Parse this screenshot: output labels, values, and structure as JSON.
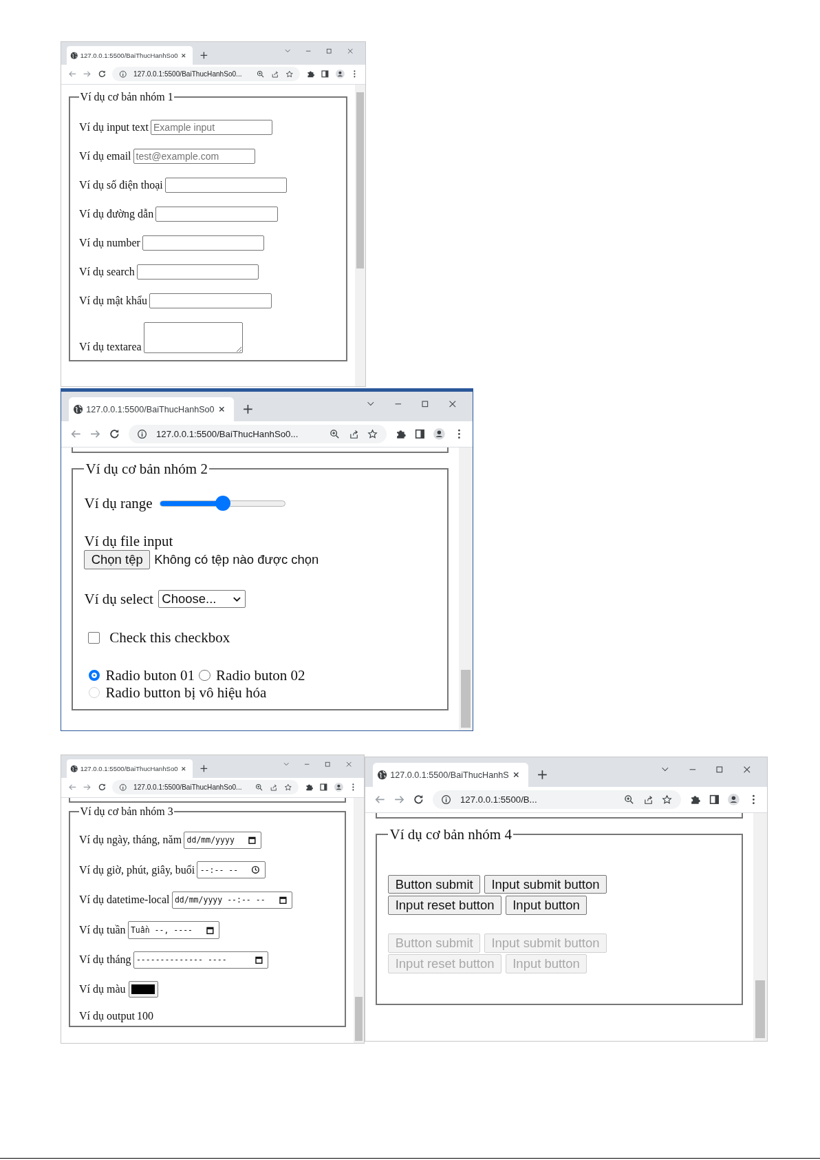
{
  "windows": [
    {
      "tab_title": "127.0.0.1:5500/BaiThucHanhSo0",
      "url": "127.0.0.1:5500/BaiThucHanhSo0...",
      "focused": false,
      "scrolled": false,
      "legend": "Ví dụ cơ bản nhóm 1",
      "rows": [
        {
          "kind": "text",
          "label": "Ví dụ input text",
          "placeholder": "Example input"
        },
        {
          "kind": "text",
          "label": "Ví dụ email",
          "placeholder": "test@example.com"
        },
        {
          "kind": "text",
          "label": "Ví dụ số điện thoại"
        },
        {
          "kind": "text",
          "label": "Ví dụ đường dẫn"
        },
        {
          "kind": "text",
          "label": "Ví dụ number"
        },
        {
          "kind": "text",
          "label": "Ví dụ search"
        },
        {
          "kind": "text",
          "label": "Ví dụ mật khẩu"
        },
        {
          "kind": "textarea",
          "label": "Ví dụ textarea"
        }
      ]
    },
    {
      "tab_title": "127.0.0.1:5500/BaiThucHanhSo0",
      "url": "127.0.0.1:5500/BaiThucHanhSo0...",
      "focused": true,
      "scrolled": true,
      "legend": "Ví dụ cơ bản nhóm 2",
      "rows": [
        {
          "kind": "range",
          "label": "Ví dụ range",
          "level": 0.5
        },
        {
          "kind": "file",
          "label": "Ví dụ file input",
          "button": "Chọn tệp",
          "status": "Không có tệp nào được chọn"
        },
        {
          "kind": "select",
          "label": "Ví dụ select",
          "value": "Choose..."
        },
        {
          "kind": "checkbox",
          "label": "Check this checkbox",
          "checked": false
        },
        {
          "kind": "radios",
          "options": [
            {
              "label": "Radio buton 01",
              "selected": true,
              "disabled": false
            },
            {
              "label": "Radio buton 02",
              "selected": false,
              "disabled": false
            },
            {
              "label": "Radio button bị vô hiệu hóa",
              "selected": false,
              "disabled": true
            }
          ]
        }
      ]
    },
    {
      "tab_title": "127.0.0.1:5500/BaiThucHanhSo0",
      "url": "127.0.0.1:5500/BaiThucHanhSo0...",
      "focused": false,
      "scrolled": true,
      "legend": "Ví dụ cơ bản nhóm 3",
      "rows": [
        {
          "kind": "date",
          "label": "Ví dụ ngày, tháng, năm",
          "value": "dd/mm/yyyy"
        },
        {
          "kind": "time",
          "label": "Ví dụ giờ, phút, giây, buổi",
          "value": "--:-- --"
        },
        {
          "kind": "datetime",
          "label": "Ví dụ datetime-local",
          "value": "dd/mm/yyyy --:-- --"
        },
        {
          "kind": "week",
          "label": "Ví dụ tuần",
          "value": "Tuần --, ----"
        },
        {
          "kind": "month",
          "label": "Ví dụ tháng",
          "value": "-------------- ----"
        },
        {
          "kind": "color",
          "label": "Ví dụ màu",
          "color": "#000000"
        },
        {
          "kind": "output",
          "label": "Ví dụ output",
          "value": "100"
        }
      ]
    },
    {
      "tab_title": "127.0.0.1:5500/BaiThucHanhS",
      "url": "127.0.0.1:5500/B...",
      "focused": false,
      "scrolled": true,
      "legend": "Ví dụ cơ bản nhóm 4",
      "rows": [
        {
          "kind": "buttons",
          "items": [
            {
              "label": "Button submit",
              "disabled": false
            },
            {
              "label": "Input submit button",
              "disabled": false
            },
            {
              "label": "Input reset button",
              "disabled": false
            },
            {
              "label": "Input button",
              "disabled": false
            }
          ]
        },
        {
          "kind": "buttons",
          "items": [
            {
              "label": "Button submit",
              "disabled": true
            },
            {
              "label": "Input submit button",
              "disabled": true
            },
            {
              "label": "Input reset button",
              "disabled": true
            },
            {
              "label": "Input button",
              "disabled": true
            }
          ]
        }
      ]
    }
  ]
}
